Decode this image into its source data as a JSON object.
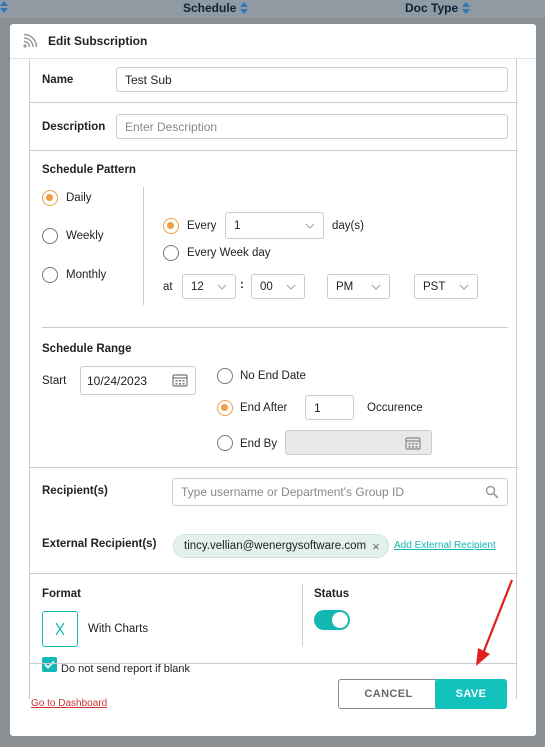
{
  "background_table": {
    "columns": [
      {
        "label": "Schedule"
      },
      {
        "label": "Doc Type"
      }
    ]
  },
  "modal": {
    "title": "Edit Subscription",
    "name": {
      "label": "Name",
      "value": "Test Sub"
    },
    "description": {
      "label": "Description",
      "placeholder": "Enter Description"
    },
    "schedule_pattern": {
      "label": "Schedule Pattern",
      "options": [
        "Daily",
        "Weekly",
        "Monthly"
      ],
      "selected": "Daily",
      "every_label": "Every",
      "every_value": "1",
      "every_unit": "day(s)",
      "every_week_day_label": "Every Week day",
      "at_label": "at",
      "hour": "12",
      "time_sep": ":",
      "minute": "00",
      "ampm": "PM",
      "timezone": "PST"
    },
    "schedule_range": {
      "label": "Schedule Range",
      "start_label": "Start",
      "start_date": "10/24/2023",
      "no_end_label": "No End Date",
      "end_after_label": "End After",
      "end_after_value": "1",
      "occurence_label": "Occurence",
      "end_by_label": "End By",
      "selected": "End After"
    },
    "recipients": {
      "label": "Recipient(s)",
      "placeholder": "Type username or Department's Group ID"
    },
    "external_recipients": {
      "label": "External Recipient(s)",
      "chips": [
        "tincy.vellian@wenergysoftware.com"
      ],
      "chip_remove": "×",
      "add_link": "Add External Recipient"
    },
    "format": {
      "label": "Format",
      "option_label": "With Charts",
      "blank_checkbox_label": "Do not send report if blank",
      "blank_checked": true
    },
    "status": {
      "label": "Status",
      "enabled": true
    },
    "footer": {
      "dashboard_link": "Go to Dashboard",
      "cancel_label": "CANCEL",
      "save_label": "SAVE"
    }
  },
  "colors": {
    "accent": "#14b7b2",
    "radio_selected": "#f0a044",
    "annotation_arrow": "#e02020"
  }
}
